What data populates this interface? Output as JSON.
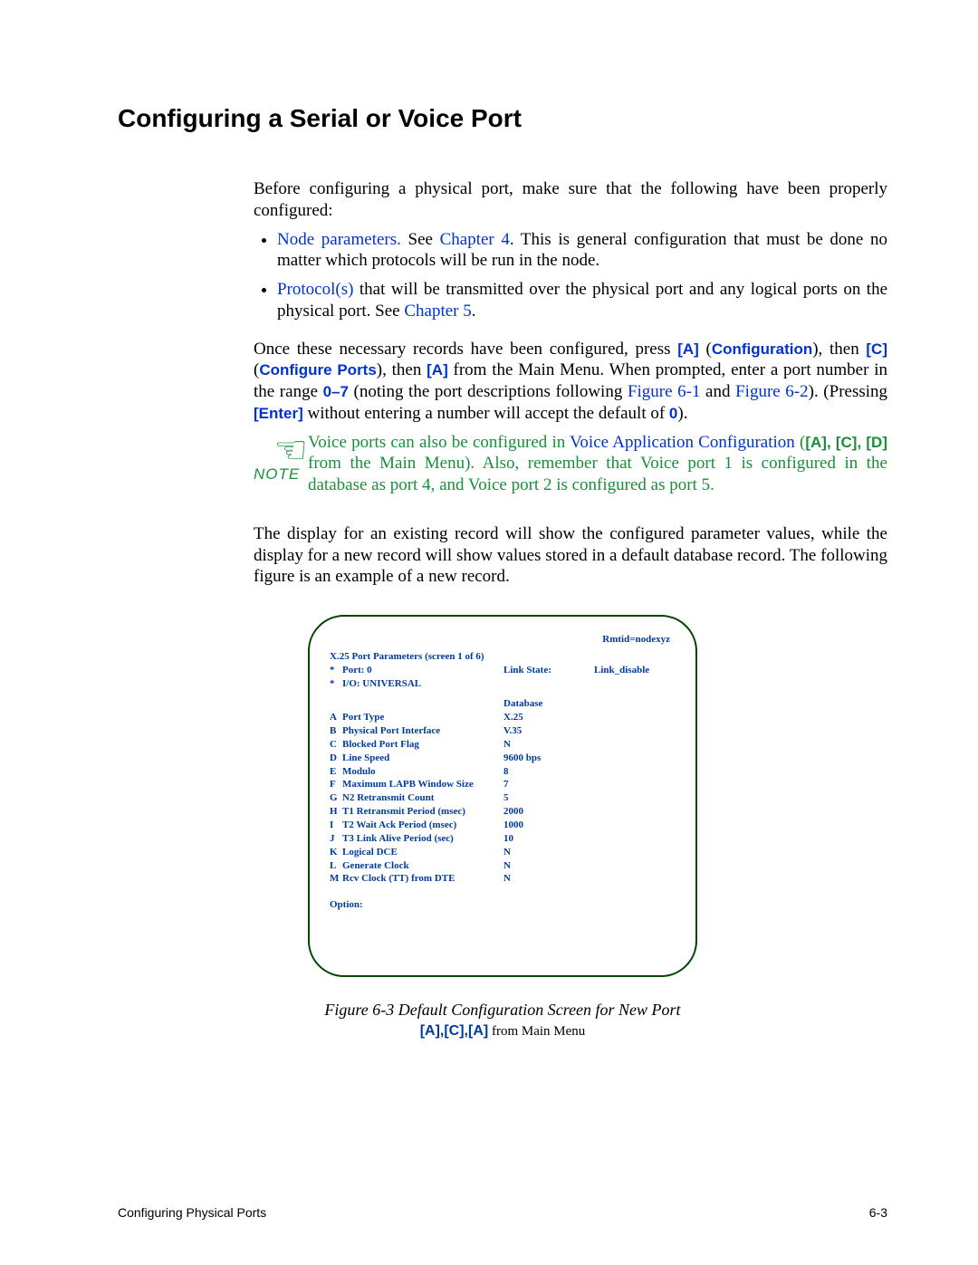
{
  "heading": "Configuring a Serial or Voice Port",
  "intro": "Before configuring a physical port, make sure that the following have been properly configured:",
  "bullet1_link": "Node parameters.",
  "bullet1_see": "See ",
  "bullet1_chap": "Chapter 4",
  "bullet1_rest": ". This is general configuration that must be done no matter which protocols will be run in the node.",
  "bullet2_link": "Protocol(s)",
  "bullet2_mid": " that will be transmitted over the physical port and any logical ports on the physical port. See ",
  "bullet2_chap": "Chapter 5",
  "bullet2_end": ".",
  "mainpara": {
    "p1a": "Once these necessary records have been configured, press ",
    "k_A1": "[A]",
    "paren1a": " (",
    "conf": "Configuration",
    "paren1b": "), then ",
    "k_C1": "[C]",
    "paren2a": " (",
    "confports": "Configure Ports",
    "paren2b": "), then ",
    "k_A2": "[A]",
    "p1b": " from the Main Menu. When prompted, enter a port number in the range ",
    "range": "0–7",
    "p1c": " (noting the port descriptions following ",
    "fig61": "Figure 6-1",
    "and": " and ",
    "fig62": "Figure 6-2",
    "p1d": "). (Pressing ",
    "enter": "[Enter]",
    "p1e": " without entering a number will accept the default of ",
    "zero": "0",
    "p1f": ")."
  },
  "note": {
    "t1": "Voice ports can also be configured in ",
    "vac": "Voice Application Configuration",
    "t2": " (",
    "keys": "[A], [C], [D]",
    "t3": " from the Main Menu). Also, remember that Voice port 1 is configured in the database as port 4, and Voice port 2 is configured as port 5."
  },
  "note_label": "NOTE",
  "afterpara": "The display for an existing record will show the configured parameter values, while the display for a new record will show values stored in a default database record. The following figure is an example of a new record.",
  "term": {
    "rmtid": "Rmtid=nodexyz",
    "title": "X.25 Port Parameters (screen 1 of 6)",
    "header_rows": [
      {
        "k": "*",
        "l": "Port: 0",
        "v": "Link State:",
        "x": "Link_disable"
      },
      {
        "k": "*",
        "l": "I/O:  UNIVERSAL",
        "v": "",
        "x": ""
      }
    ],
    "db_label": "Database",
    "rows": [
      {
        "k": "A",
        "l": "Port Type",
        "v": "X.25"
      },
      {
        "k": "B",
        "l": "Physical Port Interface",
        "v": "V.35"
      },
      {
        "k": "C",
        "l": "Blocked Port Flag",
        "v": "N"
      },
      {
        "k": "D",
        "l": "Line Speed",
        "v": "9600 bps"
      },
      {
        "k": "E",
        "l": "Modulo",
        "v": "8"
      },
      {
        "k": "F",
        "l": "Maximum LAPB Window Size",
        "v": "7"
      },
      {
        "k": "G",
        "l": "N2 Retransmit Count",
        "v": "5"
      },
      {
        "k": "H",
        "l": "T1 Retransmit Period (msec)",
        "v": "2000"
      },
      {
        "k": "I",
        "l": "T2 Wait Ack Period (msec)",
        "v": "1000"
      },
      {
        "k": "J",
        "l": "T3 Link Alive Period (sec)",
        "v": "10"
      },
      {
        "k": "K",
        "l": "Logical DCE",
        "v": "N"
      },
      {
        "k": "L",
        "l": "Generate Clock",
        "v": "N"
      },
      {
        "k": "M",
        "l": "Rcv Clock (TT) from DTE",
        "v": "N"
      }
    ],
    "option": "Option:"
  },
  "fig_caption": "Figure 6-3    Default Configuration Screen for New Port",
  "fig_sub_keys": "[A],[C],[A]",
  "fig_sub_rest": " from Main Menu",
  "footer_left": "Configuring Physical Ports",
  "footer_right": "6-3"
}
